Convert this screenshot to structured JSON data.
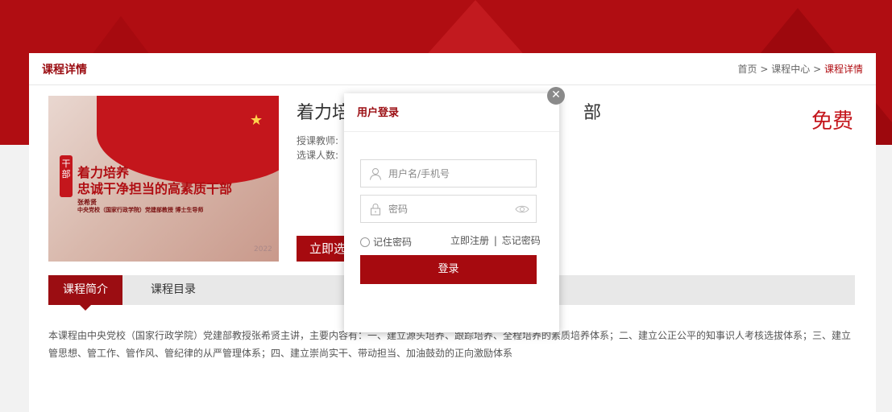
{
  "page": {
    "header_title": "课程详情",
    "breadcrumb": {
      "home": "首页",
      "sep1": ">",
      "center": "课程中心",
      "sep2": ">",
      "current": "课程详情"
    }
  },
  "course": {
    "title_visible": "着力培",
    "title_tail": "部",
    "teacher_label": "授课教师:",
    "enrolled_label": "选课人数:",
    "price": "免费",
    "enroll_button": "立即选",
    "image": {
      "tag": "干部",
      "line1": "着力培养",
      "line2": "忠诚干净担当的高素质干部",
      "line3": "张希贤",
      "line4": "中央党校（国家行政学院）党建部教授 博士生导师",
      "year": "2022"
    }
  },
  "tabs": [
    {
      "label": "课程简介",
      "active": true
    },
    {
      "label": "课程目录",
      "active": false
    }
  ],
  "description": "本课程由中央党校（国家行政学院）党建部教授张希贤主讲，主要内容有：一、建立源头培养、跟踪培养、全程培养的素质培养体系；二、建立公正公平的知事识人考核选拔体系；三、建立管思想、管工作、管作风、管纪律的从严管理体系；四、建立崇尚实干、带动担当、加油鼓劲的正向激励体系",
  "login_modal": {
    "title": "用户登录",
    "username_placeholder": "用户名/手机号",
    "password_placeholder": "密码",
    "remember_label": "记住密码",
    "register_link": "立即注册",
    "separator": "|",
    "forgot_link": "忘记密码",
    "login_button": "登录",
    "close_icon": "close-icon"
  },
  "colors": {
    "brand_red": "#a60a0f",
    "title_red": "#9b0d12",
    "price_red": "#c4161c"
  }
}
